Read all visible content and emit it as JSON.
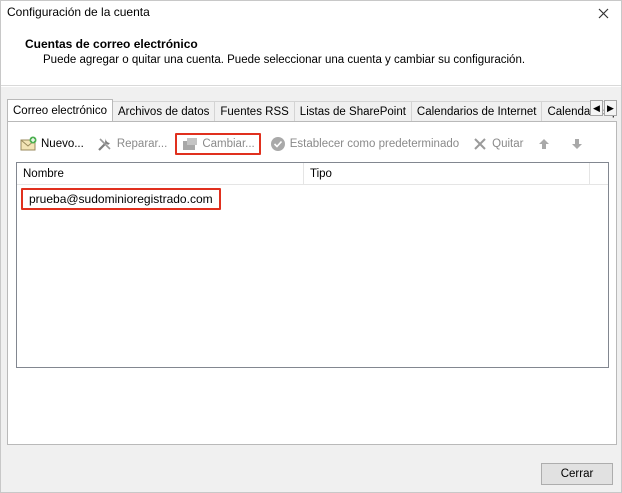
{
  "window": {
    "title": "Configuración de la cuenta"
  },
  "header": {
    "title": "Cuentas de correo electrónico",
    "description": "Puede agregar o quitar una cuenta. Puede seleccionar una cuenta y cambiar su configuración."
  },
  "tabs": [
    {
      "label": "Correo electrónico",
      "active": true
    },
    {
      "label": "Archivos de datos",
      "active": false
    },
    {
      "label": "Fuentes RSS",
      "active": false
    },
    {
      "label": "Listas de SharePoint",
      "active": false
    },
    {
      "label": "Calendarios de Internet",
      "active": false
    },
    {
      "label": "Calendarios p",
      "active": false
    }
  ],
  "toolbar": {
    "new_label": "Nuevo...",
    "repair_label": "Reparar...",
    "change_label": "Cambiar...",
    "set_default_label": "Establecer como predeterminado",
    "remove_label": "Quitar"
  },
  "list": {
    "columns": [
      "Nombre",
      "Tipo"
    ],
    "rows": [
      {
        "name": "prueba@sudominioregistrado.com",
        "type": ""
      }
    ]
  },
  "footer": {
    "close_label": "Cerrar"
  },
  "colors": {
    "highlight": "#e0301e"
  }
}
